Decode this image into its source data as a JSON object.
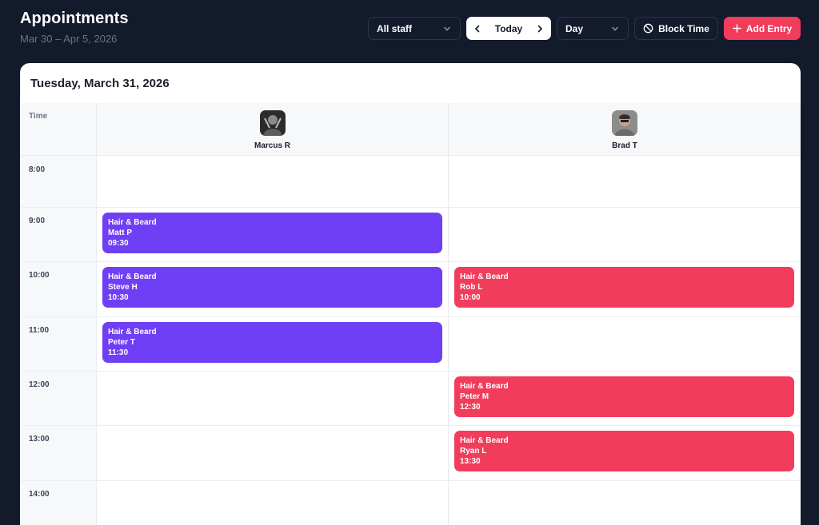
{
  "header": {
    "title": "Appointments",
    "date_range": "Mar 30 – Apr 5, 2026"
  },
  "toolbar": {
    "staff_filter": "All staff",
    "today_label": "Today",
    "view_mode": "Day",
    "block_time_label": "Block Time",
    "add_entry_label": "Add Entry"
  },
  "calendar": {
    "day_title": "Tuesday, March 31, 2026",
    "time_header": "Time",
    "staff": [
      {
        "name": "Marcus R"
      },
      {
        "name": "Brad T"
      }
    ],
    "hours": [
      "8:00",
      "9:00",
      "10:00",
      "11:00",
      "12:00",
      "13:00",
      "14:00"
    ],
    "appointments": [
      {
        "service": "Hair & Beard",
        "client": "Matt P",
        "time": "09:30",
        "staff": 0,
        "start_hour": 9.0
      },
      {
        "service": "Hair & Beard",
        "client": "Steve H",
        "time": "10:30",
        "staff": 0,
        "start_hour": 10.0
      },
      {
        "service": "Hair & Beard",
        "client": "Peter T",
        "time": "11:30",
        "staff": 0,
        "start_hour": 11.0
      },
      {
        "service": "Hair & Beard",
        "client": "Rob L",
        "time": "10:00",
        "staff": 1,
        "start_hour": 10.0
      },
      {
        "service": "Hair & Beard",
        "client": "Peter M",
        "time": "12:30",
        "staff": 1,
        "start_hour": 12.0
      },
      {
        "service": "Hair & Beard",
        "client": "Ryan L",
        "time": "13:30",
        "staff": 1,
        "start_hour": 13.0
      }
    ]
  },
  "colors": {
    "background": "#131a2b",
    "accent_red": "#f23c5b",
    "accent_purple": "#6f3ff5"
  }
}
